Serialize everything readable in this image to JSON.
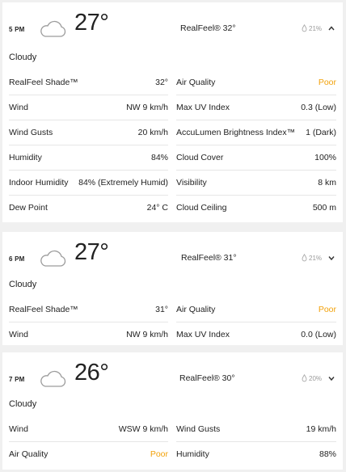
{
  "hours": [
    {
      "time": "5 PM",
      "icon": "cloud-icon",
      "temp": "27°",
      "realfeel": "RealFeel® 32°",
      "precip": "21%",
      "expanded": true,
      "toggle_icon": "chevron-up-icon",
      "phrase": "Cloudy",
      "details_left": [
        {
          "label": "RealFeel Shade™",
          "value": "32°"
        },
        {
          "label": "Wind",
          "value": "NW 9 km/h"
        },
        {
          "label": "Wind Gusts",
          "value": "20 km/h"
        },
        {
          "label": "Humidity",
          "value": "84%"
        },
        {
          "label": "Indoor Humidity",
          "value": "84% (Extremely Humid)"
        },
        {
          "label": "Dew Point",
          "value": "24° C"
        }
      ],
      "details_right": [
        {
          "label": "Air Quality",
          "value": "Poor"
        },
        {
          "label": "Max UV Index",
          "value": "0.3 (Low)"
        },
        {
          "label": "AccuLumen Brightness Index™",
          "value": "1 (Dark)"
        },
        {
          "label": "Cloud Cover",
          "value": "100%"
        },
        {
          "label": "Visibility",
          "value": "8 km"
        },
        {
          "label": "Cloud Ceiling",
          "value": "500 m"
        }
      ]
    },
    {
      "time": "6 PM",
      "icon": "cloud-icon",
      "temp": "27°",
      "realfeel": "RealFeel® 31°",
      "precip": "21%",
      "expanded": false,
      "toggle_icon": "chevron-down-icon",
      "phrase": "Cloudy",
      "details_left": [
        {
          "label": "RealFeel Shade™",
          "value": "31°"
        },
        {
          "label": "Wind",
          "value": "NW 9 km/h"
        }
      ],
      "details_right": [
        {
          "label": "Air Quality",
          "value": "Poor"
        },
        {
          "label": "Max UV Index",
          "value": "0.0 (Low)"
        }
      ]
    },
    {
      "time": "7 PM",
      "icon": "cloud-icon",
      "temp": "26°",
      "realfeel": "RealFeel® 30°",
      "precip": "20%",
      "expanded": false,
      "toggle_icon": "chevron-down-icon",
      "phrase": "Cloudy",
      "details_left": [
        {
          "label": "Wind",
          "value": "WSW 9 km/h"
        },
        {
          "label": "Air Quality",
          "value": "Poor"
        }
      ],
      "details_right": [
        {
          "label": "Wind Gusts",
          "value": "19 km/h"
        },
        {
          "label": "Humidity",
          "value": "88%"
        }
      ]
    }
  ],
  "colors": {
    "background": "#f0f0f0",
    "card": "#ffffff",
    "poor": "#f2a20b",
    "muted": "#9a9a9a",
    "divider": "#e6e6e6"
  }
}
